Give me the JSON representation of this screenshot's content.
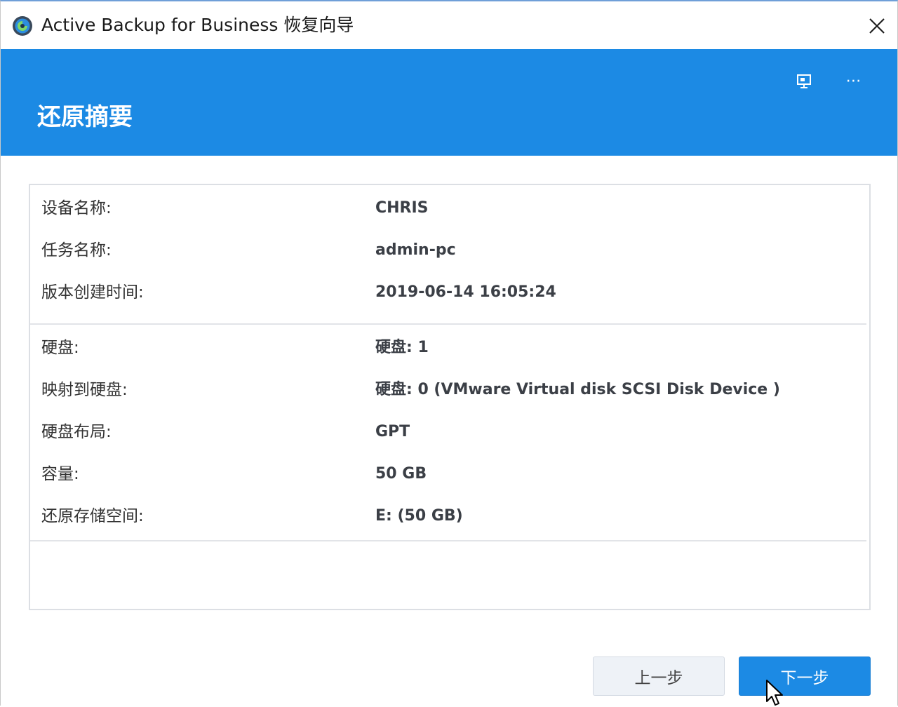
{
  "window": {
    "title": "Active Backup for Business 恢复向导"
  },
  "header": {
    "title": "还原摘要"
  },
  "summary": {
    "section1": [
      {
        "label": "设备名称:",
        "value": "CHRIS"
      },
      {
        "label": "任务名称:",
        "value": "admin-pc"
      },
      {
        "label": "版本创建时间:",
        "value": "2019-06-14 16:05:24"
      }
    ],
    "section2": [
      {
        "label": "硬盘:",
        "value": "硬盘: 1"
      },
      {
        "label": "映射到硬盘:",
        "value": "硬盘: 0 (VMware Virtual disk SCSI Disk Device )"
      },
      {
        "label": "硬盘布局:",
        "value": "GPT"
      },
      {
        "label": "容量:",
        "value": "50 GB"
      },
      {
        "label": "还原存储空间:",
        "value": "E: (50 GB)"
      }
    ]
  },
  "footer": {
    "prev_label": "上一步",
    "next_label": "下一步"
  },
  "icons": {
    "app": "active-backup-icon",
    "close": "close-icon",
    "support": "support-center-icon",
    "more": "more-icon",
    "cursor": "mouse-cursor-icon"
  },
  "colors": {
    "accent": "#1c8ae4",
    "prev_button_bg": "#eef2f7",
    "label_text": "#333333",
    "value_text": "#3b3f46"
  }
}
